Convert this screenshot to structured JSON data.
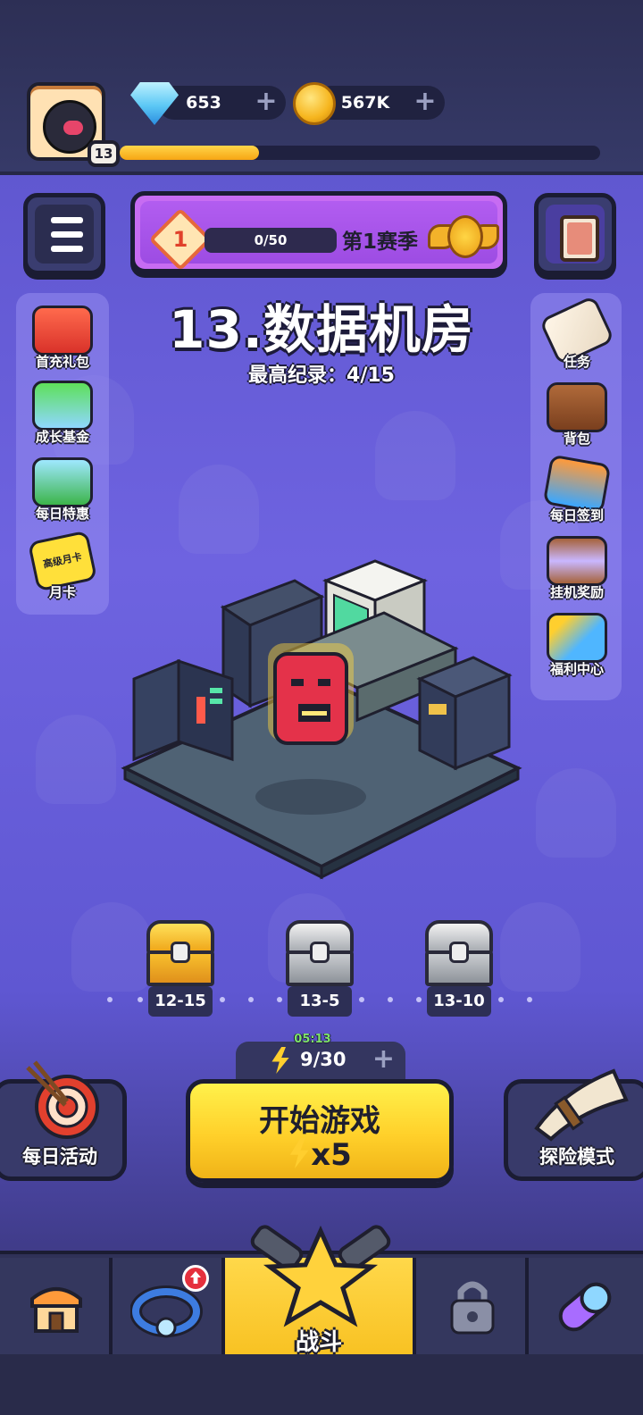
{
  "resources": {
    "gems": "653",
    "gems_add": "+",
    "coins": "567K",
    "coins_add": "+"
  },
  "player": {
    "level": "13",
    "xp_progress": 0.29
  },
  "season": {
    "level": "1",
    "progress_text": "0/50",
    "title": "第1赛季"
  },
  "stage": {
    "title": "13.数据机房",
    "record": "最高纪录：4/15"
  },
  "left_menu": [
    {
      "label": "首充礼包",
      "icon": "gift-pack-icon"
    },
    {
      "label": "成长基金",
      "icon": "growth-fund-icon"
    },
    {
      "label": "每日特惠",
      "icon": "daily-deal-basket-icon"
    },
    {
      "label": "月卡",
      "card_text": "高级月卡",
      "icon": "monthly-card-icon"
    }
  ],
  "right_menu": [
    {
      "label": "任务",
      "icon": "quest-scroll-icon"
    },
    {
      "label": "背包",
      "icon": "backpack-icon"
    },
    {
      "label": "每日签到",
      "icon": "daily-checkin-icon"
    },
    {
      "label": "挂机奖励",
      "icon": "idle-reward-hourglass-icon"
    },
    {
      "label": "福利中心",
      "icon": "welfare-megaphone-icon"
    }
  ],
  "chests": [
    {
      "label": "12-15",
      "type": "gold"
    },
    {
      "label": "13-5",
      "type": "silver"
    },
    {
      "label": "13-10",
      "type": "silver"
    }
  ],
  "energy": {
    "timer": "05:13",
    "value": "9/30",
    "add": "+"
  },
  "start_button": {
    "title": "开始游戏",
    "cost": "x5"
  },
  "modes": {
    "daily_activity": "每日活动",
    "adventure": "探险模式"
  },
  "bottom_nav": {
    "battle_label": "战斗",
    "items": [
      "shop-icon",
      "equipment-ring-icon",
      "battle-star-icon",
      "lock-icon",
      "capsule-icon"
    ]
  },
  "colors": {
    "accent_yellow": "#ffd02a",
    "season_purple": "#b25df0",
    "bg_purple": "#6a5fd8"
  }
}
